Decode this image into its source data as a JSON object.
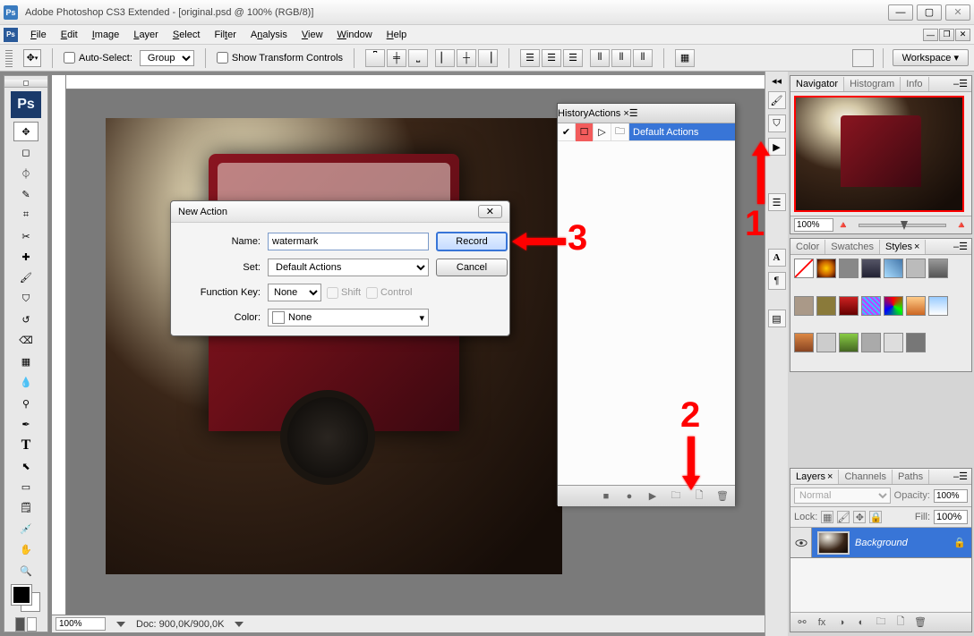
{
  "window": {
    "title": "Adobe Photoshop CS3 Extended - [original.psd @ 100% (RGB/8)]"
  },
  "menus": [
    "File",
    "Edit",
    "Image",
    "Layer",
    "Select",
    "Filter",
    "Analysis",
    "View",
    "Window",
    "Help"
  ],
  "options": {
    "auto_select": "Auto-Select:",
    "auto_select_mode": "Group",
    "show_transform": "Show Transform Controls",
    "workspace_label": "Workspace ▾"
  },
  "status": {
    "zoom": "100%",
    "doc": "Doc: 900,0K/900,0K"
  },
  "navigator": {
    "tabs": [
      "Navigator",
      "Histogram",
      "Info"
    ],
    "zoom": "100%"
  },
  "color_panel": {
    "tabs": [
      "Color",
      "Swatches",
      "Styles"
    ]
  },
  "layers_panel": {
    "tabs": [
      "Layers",
      "Channels",
      "Paths"
    ],
    "blend": "Normal",
    "opacity_label": "Opacity:",
    "opacity": "100%",
    "lock_label": "Lock:",
    "fill_label": "Fill:",
    "fill": "100%",
    "layer_name": "Background"
  },
  "actions_panel": {
    "tabs": [
      "History",
      "Actions"
    ],
    "default_set": "Default Actions"
  },
  "dialog": {
    "title": "New Action",
    "name_label": "Name:",
    "name_value": "watermark",
    "set_label": "Set:",
    "set_value": "Default Actions",
    "fk_label": "Function Key:",
    "fk_value": "None",
    "shift_label": "Shift",
    "control_label": "Control",
    "color_label": "Color:",
    "color_value": "None",
    "record": "Record",
    "cancel": "Cancel"
  },
  "annot": {
    "n1": "1",
    "n2": "2",
    "n3": "3"
  }
}
